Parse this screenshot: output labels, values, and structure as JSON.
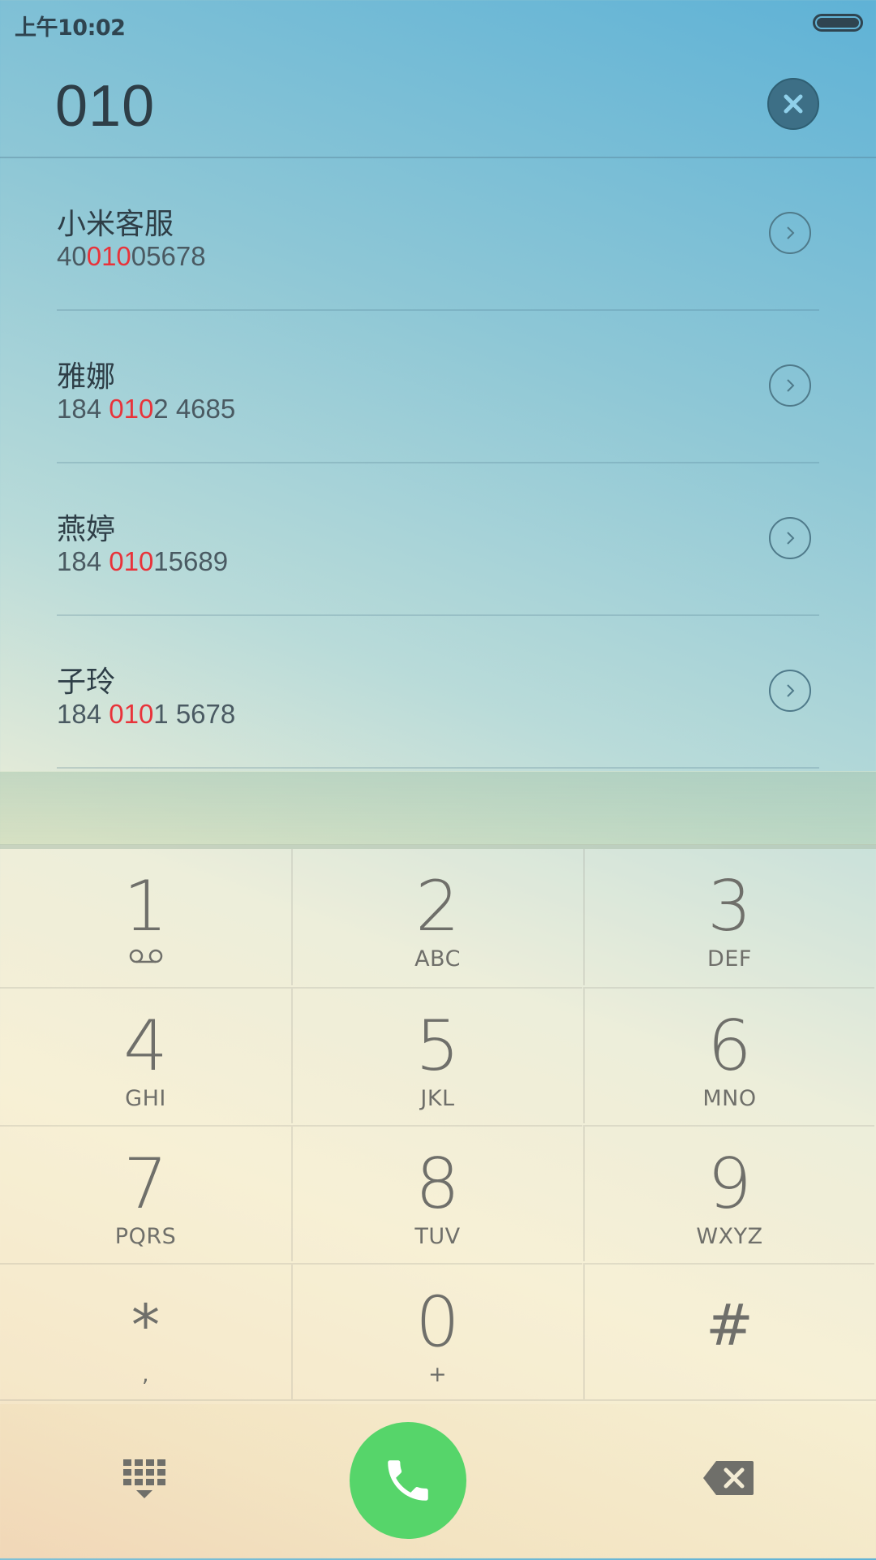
{
  "status_bar": {
    "time": "上午10:02"
  },
  "dial_input": {
    "value": "010"
  },
  "results": [
    {
      "name": "小米客服",
      "number_parts": [
        "40",
        "010",
        "05678"
      ]
    },
    {
      "name": "雅娜",
      "number_parts": [
        "184 ",
        "010",
        "2 4685"
      ]
    },
    {
      "name": "燕婷",
      "number_parts": [
        "184 ",
        "010",
        "15689"
      ]
    },
    {
      "name": "子玲",
      "number_parts": [
        "184 ",
        "010",
        "1 5678"
      ]
    }
  ],
  "keypad": [
    {
      "digit": "1",
      "letters": "voicemail"
    },
    {
      "digit": "2",
      "letters": "ABC"
    },
    {
      "digit": "3",
      "letters": "DEF"
    },
    {
      "digit": "4",
      "letters": "GHI"
    },
    {
      "digit": "5",
      "letters": "JKL"
    },
    {
      "digit": "6",
      "letters": "MNO"
    },
    {
      "digit": "7",
      "letters": "PQRS"
    },
    {
      "digit": "8",
      "letters": "TUV"
    },
    {
      "digit": "9",
      "letters": "WXYZ"
    },
    {
      "digit": "*",
      "letters": ","
    },
    {
      "digit": "0",
      "letters": "+"
    },
    {
      "digit": "#",
      "letters": ""
    }
  ],
  "colors": {
    "highlight": "#e8333a",
    "call_green": "#56d56a",
    "text_dark": "#2e3e47"
  },
  "icons": [
    "battery-icon",
    "clear-icon",
    "chevron-right-icon",
    "voicemail-icon",
    "dialpad-icon",
    "phone-icon",
    "backspace-icon"
  ]
}
